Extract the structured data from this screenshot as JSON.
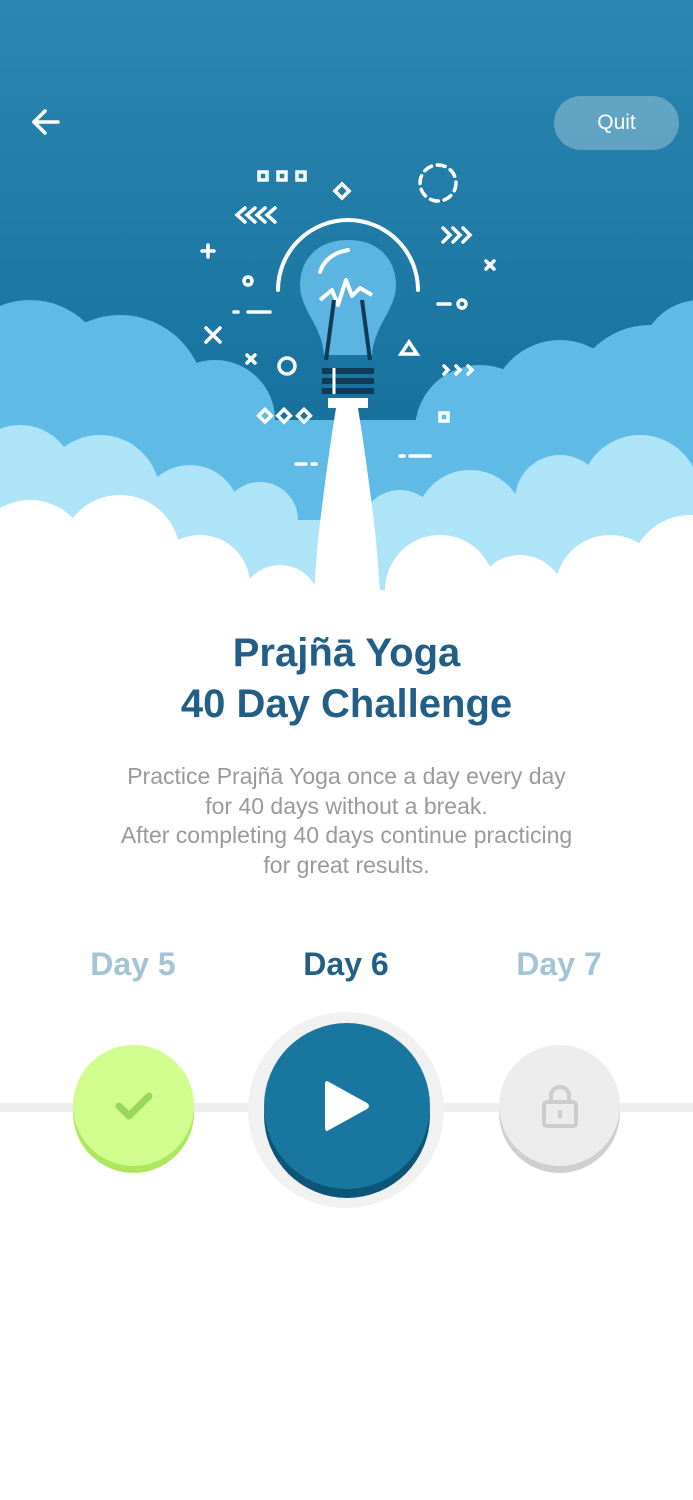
{
  "header": {
    "back_icon": "arrow-left-icon",
    "quit_label": "Quit"
  },
  "hero": {
    "illustration": "lightbulb-rocket-launching-through-clouds",
    "colors": {
      "sky_top": "#2b86b2",
      "sky_bottom": "#0f6894",
      "cloud_light": "#aee4f8",
      "cloud_mid": "#5fbbe6"
    }
  },
  "title": {
    "line1": "Prajñā Yoga",
    "line2": "40 Day Challenge"
  },
  "description": {
    "line1": "Practice Prajñā Yoga once a day every day",
    "line2": "for 40 days without a break.",
    "line3": "After completing 40 days continue practicing",
    "line4": "for great results."
  },
  "days": {
    "previous": {
      "label": "Day 5",
      "status": "completed",
      "icon": "checkmark-icon"
    },
    "current": {
      "label": "Day 6",
      "status": "available",
      "icon": "play-icon"
    },
    "next": {
      "label": "Day 7",
      "status": "locked",
      "icon": "lock-icon"
    }
  },
  "colors": {
    "title": "#225f86",
    "body_text": "#9a9a9a",
    "inactive_day": "#a4c3d4",
    "completed": "#d0fd8d",
    "current": "#19779f",
    "locked": "#ececec"
  }
}
